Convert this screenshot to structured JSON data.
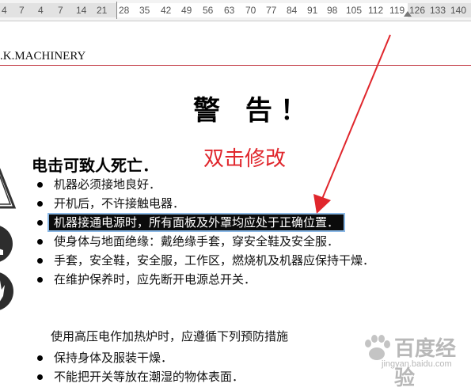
{
  "ruler": {
    "ticks": [
      "4",
      "7",
      "4",
      "7",
      "14",
      "21",
      "28",
      "35",
      "42",
      "49",
      "56",
      "63",
      "70",
      "77",
      "84",
      "91",
      "98",
      "105",
      "112",
      "119",
      "126",
      "133",
      "140"
    ]
  },
  "header": {
    "company": ".K.MACHINERY"
  },
  "document": {
    "title": "警 告！",
    "annotation": "双击修改",
    "section_heading": "电击可致人死亡．",
    "bullets_1": [
      "机器必须接地良好．",
      "开机后，不许接触电器．",
      "机器接通电源时，所有面板及外罩均应处于正确位置．",
      "使身体与地面绝缘：戴绝缘手套，穿安全鞋及安全服．",
      "手套，安全鞋，安全服，工作区，燃烧机及机器应保持干燥．",
      "在维护保养时，应先断开电源总开关．"
    ],
    "plain_line": "使用高压电作加热炉时，应遵循下列预防措施",
    "bullets_2": [
      "保持身体及服装干燥．",
      "不能把开关等放在潮湿的物体表面．"
    ]
  },
  "watermark": {
    "text": "百度经验",
    "url": "jingyan.baidu.com"
  },
  "colors": {
    "annotation": "#e0262c",
    "arrow": "#e0262c",
    "header_rule": "#c0313b",
    "selection": "#0b0b0b"
  }
}
